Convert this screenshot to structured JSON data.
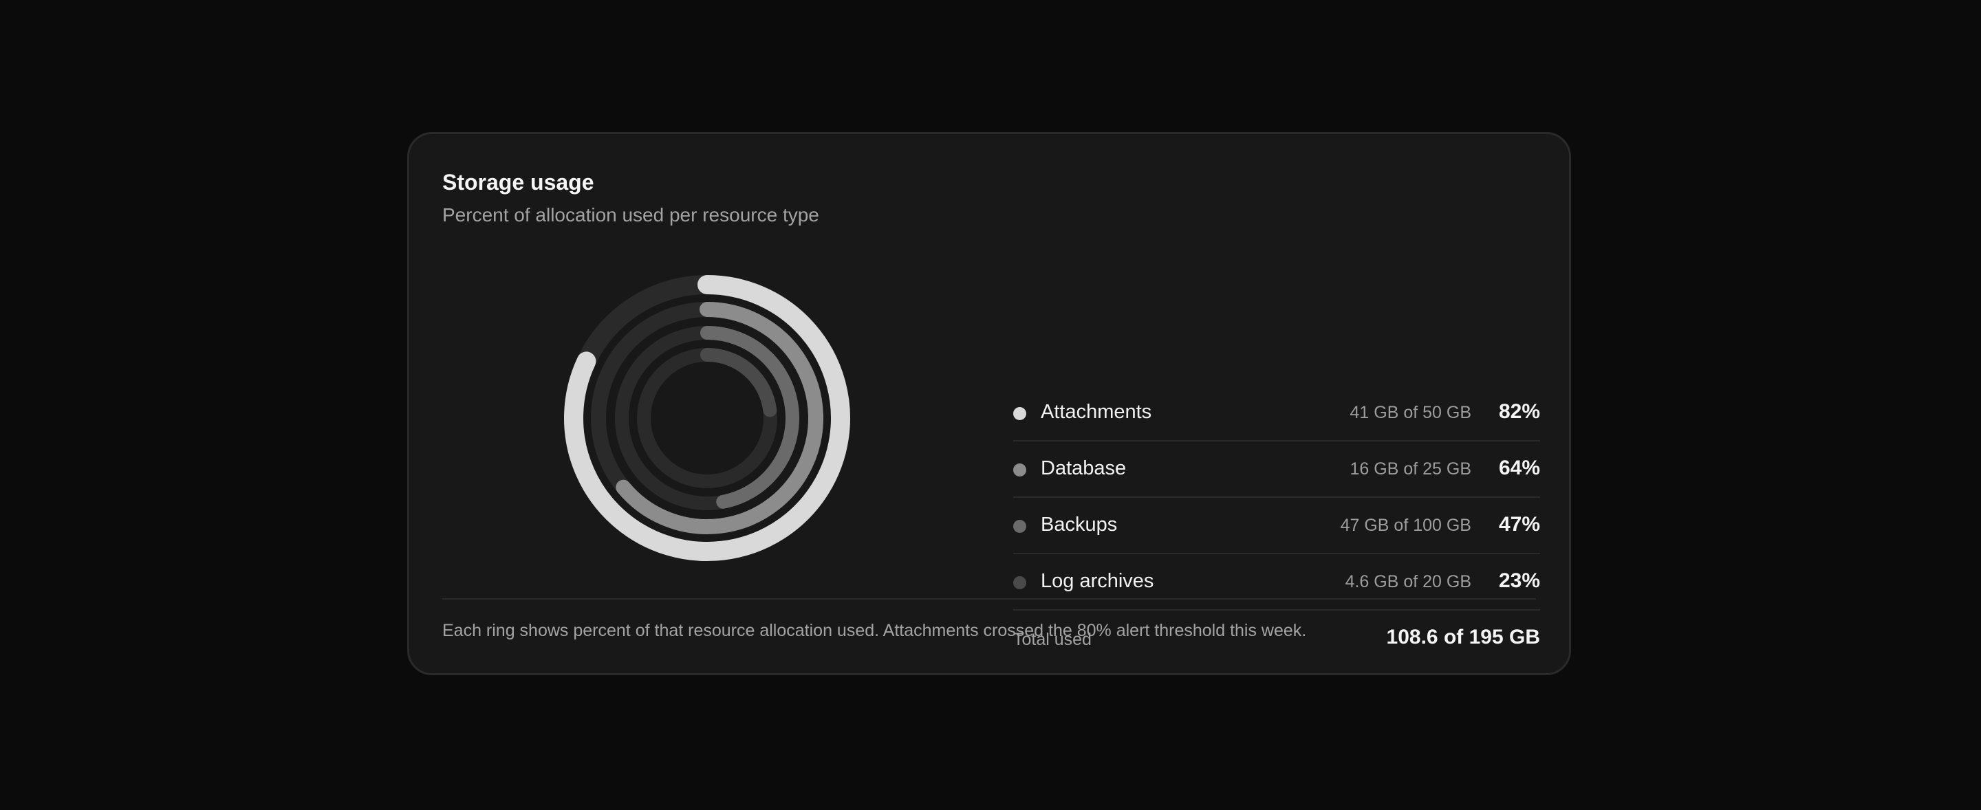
{
  "card": {
    "title": "Storage usage",
    "subtitle": "Percent of allocation used per resource type",
    "footnote": "Each ring shows percent of that resource allocation used. Attachments crossed the 80% alert threshold this week."
  },
  "legend": {
    "items": [
      {
        "label": "Attachments",
        "detail": "41 GB of 50 GB",
        "pct": "82%",
        "color": "#d9d9d9"
      },
      {
        "label": "Database",
        "detail": "16 GB of 25 GB",
        "pct": "64%",
        "color": "#8c8c8c"
      },
      {
        "label": "Backups",
        "detail": "47 GB of 100 GB",
        "pct": "47%",
        "color": "#6a6a6a"
      },
      {
        "label": "Log archives",
        "detail": "4.6 GB of 20 GB",
        "pct": "23%",
        "color": "#4a4a4a"
      }
    ],
    "total_label": "Total used",
    "total_value": "108.6 of 195 GB"
  },
  "chart_data": {
    "type": "radial-bar",
    "unit": "%",
    "max": 100,
    "series": [
      {
        "name": "Attachments",
        "value": 82,
        "color": "#d9d9d9"
      },
      {
        "name": "Database",
        "value": 64,
        "color": "#8c8c8c"
      },
      {
        "name": "Backups",
        "value": 47,
        "color": "#6a6a6a"
      },
      {
        "name": "Log archives",
        "value": 23,
        "color": "#4a4a4a"
      }
    ],
    "track_color": "#2a2a2a",
    "start_angle": "top",
    "direction": "clockwise"
  }
}
